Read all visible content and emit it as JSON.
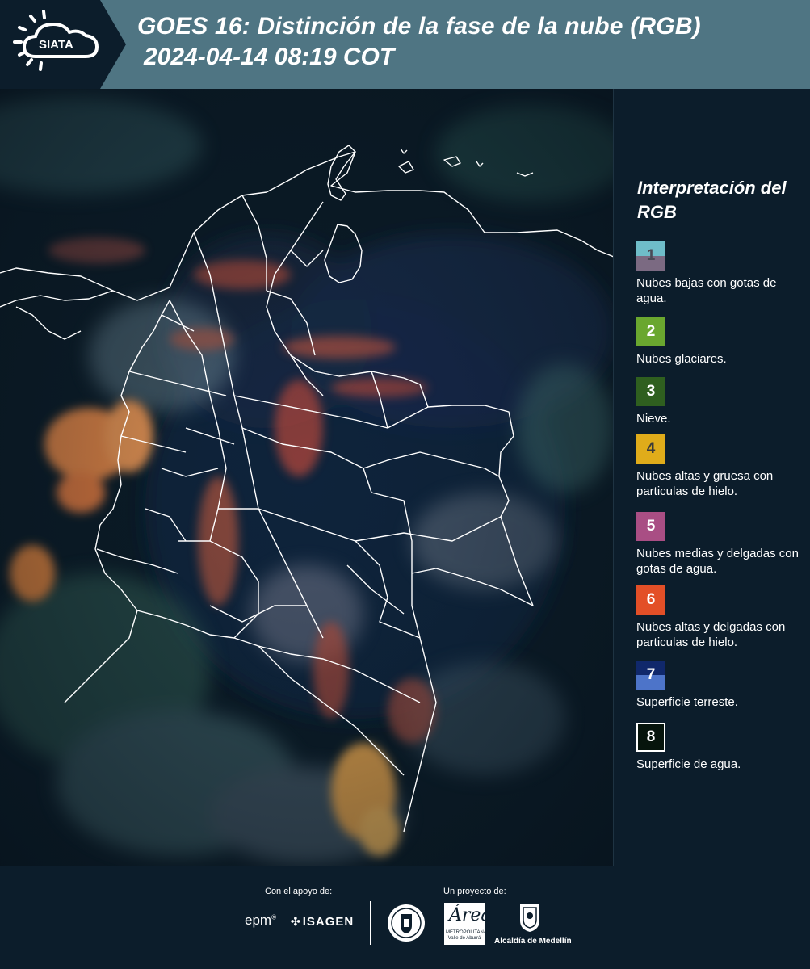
{
  "header": {
    "logo_text": "SIATA",
    "title": "GOES 16: Distinción de la fase de la nube (RGB)",
    "datetime": "2024-04-14 08:19 COT"
  },
  "legend": {
    "title": "Interpretación del RGB",
    "items": [
      {
        "number": "1",
        "label": "Nubes bajas con gotas de agua.",
        "color_top": "#6fbdc9",
        "color_bottom": "#7b6a82"
      },
      {
        "number": "2",
        "label": "Nubes glaciares.",
        "color": "#6aa72f"
      },
      {
        "number": "3",
        "label": "Nieve.",
        "color": "#2f5f1f"
      },
      {
        "number": "4",
        "label": "Nubes altas y gruesa con particulas de hielo.",
        "color": "#e0ac1a"
      },
      {
        "number": "5",
        "label": "Nubes medias y delgadas con gotas de agua.",
        "color": "#a94e84"
      },
      {
        "number": "6",
        "label": "Nubes altas y delgadas con particulas de hielo.",
        "color": "#e34f27"
      },
      {
        "number": "7",
        "label": "Superficie terreste.",
        "color_top": "#10286b",
        "color_bottom": "#4d74c9"
      },
      {
        "number": "8",
        "label": "Superficie de agua.",
        "color": "#06140c",
        "border": "#ffffff"
      }
    ]
  },
  "footer": {
    "support_label": "Con el apoyo de:",
    "project_label": "Un proyecto de:",
    "epm": "epm",
    "isagen": "ISAGEN",
    "area_logo_letters": "Área",
    "area_logo_text": "METROPOLITANA Valle de Aburrá",
    "alcaldia": "Alcaldía de Medellín"
  }
}
